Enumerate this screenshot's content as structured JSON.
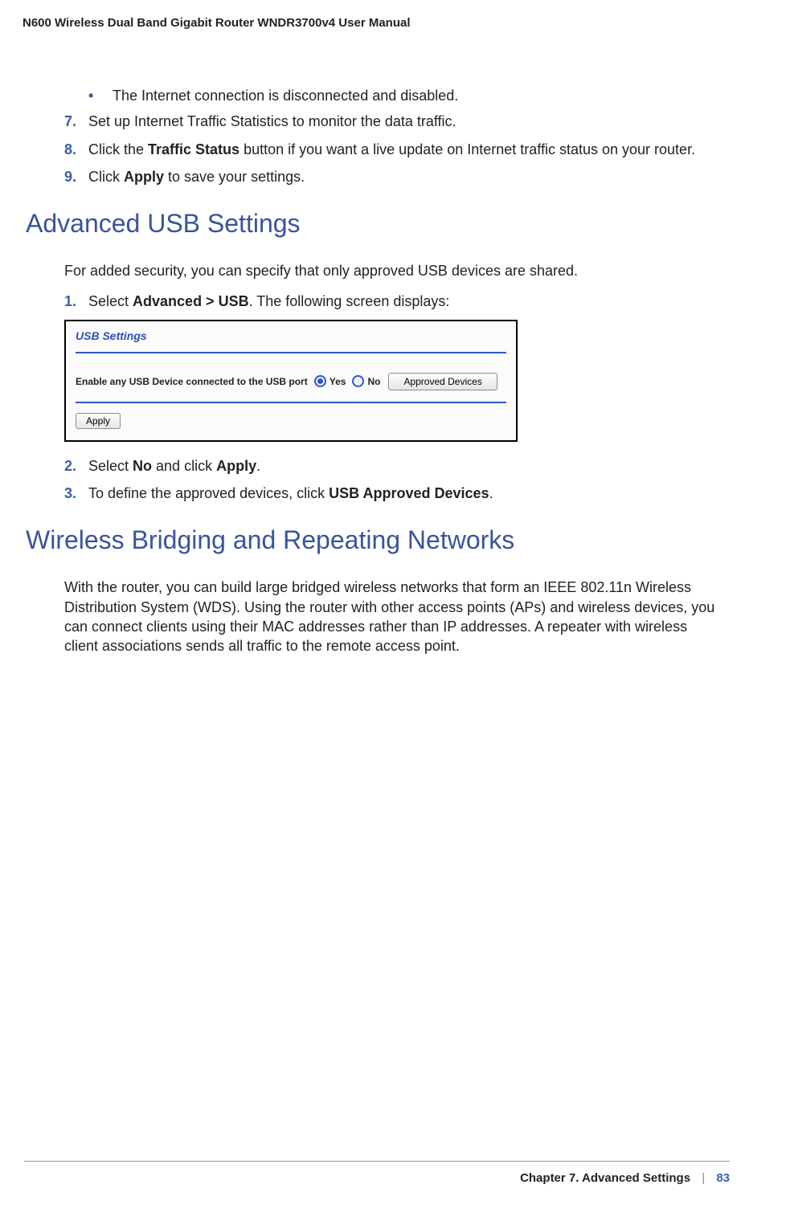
{
  "header": {
    "manual_title": "N600 Wireless Dual Band Gigabit Router WNDR3700v4 User Manual"
  },
  "body": {
    "bullet_text": "The Internet connection is disconnected and disabled.",
    "step7_text": "Set up Internet Traffic Statistics to monitor the data traffic.",
    "step8_prefix": "Click the ",
    "step8_bold": "Traffic Status",
    "step8_suffix": " button if you want a live update on Internet traffic status on your router.",
    "step9_prefix": "Click ",
    "step9_bold": "Apply",
    "step9_suffix": " to save your settings.",
    "num7": "7.",
    "num8": "8.",
    "num9": "9."
  },
  "section_usb": {
    "heading": "Advanced USB Settings",
    "intro": "For added security, you can specify that only approved USB devices are shared.",
    "step1_num": "1.",
    "step1_prefix": "Select ",
    "step1_bold": "Advanced > USB",
    "step1_suffix": ". The following screen displays:",
    "step2_num": "2.",
    "step2_prefix": "Select ",
    "step2_bold1": "No",
    "step2_mid": " and click ",
    "step2_bold2": "Apply",
    "step2_suffix": ".",
    "step3_num": "3.",
    "step3_prefix": "To define the approved devices, click ",
    "step3_bold": "USB Approved Devices",
    "step3_suffix": "."
  },
  "screenshot": {
    "title": "USB Settings",
    "enable_label": "Enable any USB Device connected to the USB port",
    "yes": "Yes",
    "no": "No",
    "approved_btn": "Approved Devices",
    "apply_btn": "Apply"
  },
  "section_wds": {
    "heading": "Wireless Bridging and Repeating Networks",
    "para": "With the router, you can build large bridged wireless networks that form an IEEE 802.11n Wireless Distribution System (WDS). Using the router with other access points (APs) and wireless devices, you can connect clients using their MAC addresses rather than IP addresses. A repeater with wireless client associations sends all traffic to the remote access point."
  },
  "footer": {
    "chapter": "Chapter 7.  Advanced Settings",
    "separator": "|",
    "page": "83"
  }
}
